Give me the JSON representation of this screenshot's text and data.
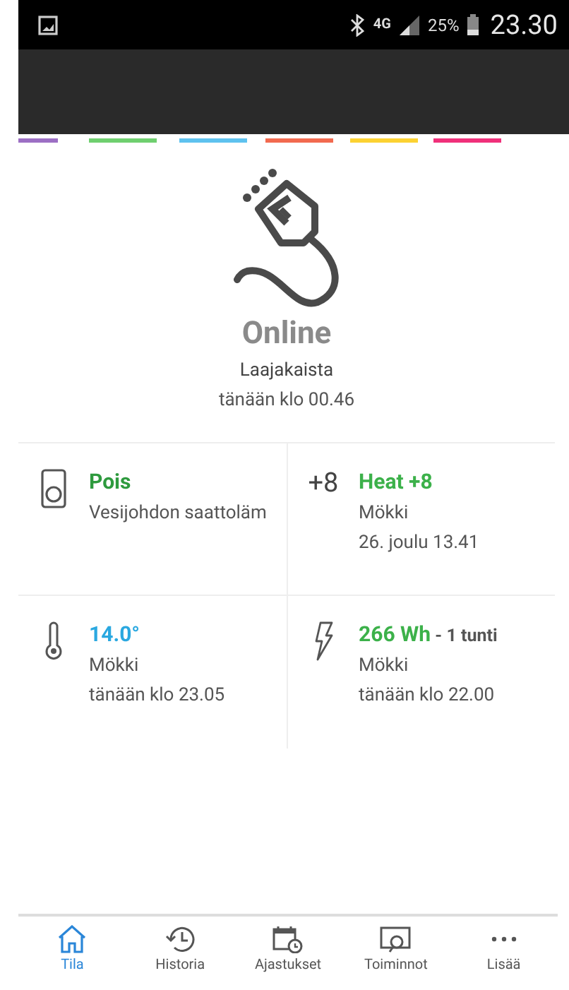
{
  "status_bar": {
    "network": "4G",
    "battery": "25%",
    "time": "23.30"
  },
  "accent_stripes": [
    {
      "color": "#9c6fc4"
    },
    {
      "color": "#6fcf6f"
    },
    {
      "color": "#5ec2ef"
    },
    {
      "color": "#f26a4f"
    },
    {
      "color": "#fcd232"
    },
    {
      "color": "#f0307a"
    }
  ],
  "connection": {
    "status": "Online",
    "type": "Laajakaista",
    "time": "tänään klo 00.46"
  },
  "tiles": [
    {
      "kind": "socket",
      "title": "Pois",
      "color": "#2e9a3e",
      "lines": [
        "Vesijohdon saattoläm"
      ]
    },
    {
      "kind": "text",
      "icon_text": "+8",
      "title": "Heat +8",
      "color": "#3cb14a",
      "lines": [
        "Mökki",
        "26. joulu 13.41"
      ]
    },
    {
      "kind": "thermometer",
      "title": "14.0°",
      "color": "#2aa8e0",
      "lines": [
        "Mökki",
        "tänään klo 23.05"
      ]
    },
    {
      "kind": "bolt",
      "title": "266 Wh",
      "suffix": " - 1 tunti",
      "color": "#3cb14a",
      "lines": [
        "Mökki",
        "tänään klo 22.00"
      ]
    }
  ],
  "nav": [
    {
      "label": "Tila",
      "kind": "home",
      "selected": true
    },
    {
      "label": "Historia",
      "kind": "history",
      "selected": false
    },
    {
      "label": "Ajastukset",
      "kind": "calendar",
      "selected": false
    },
    {
      "label": "Toiminnot",
      "kind": "action",
      "selected": false
    },
    {
      "label": "Lisää",
      "kind": "more",
      "selected": false
    }
  ]
}
